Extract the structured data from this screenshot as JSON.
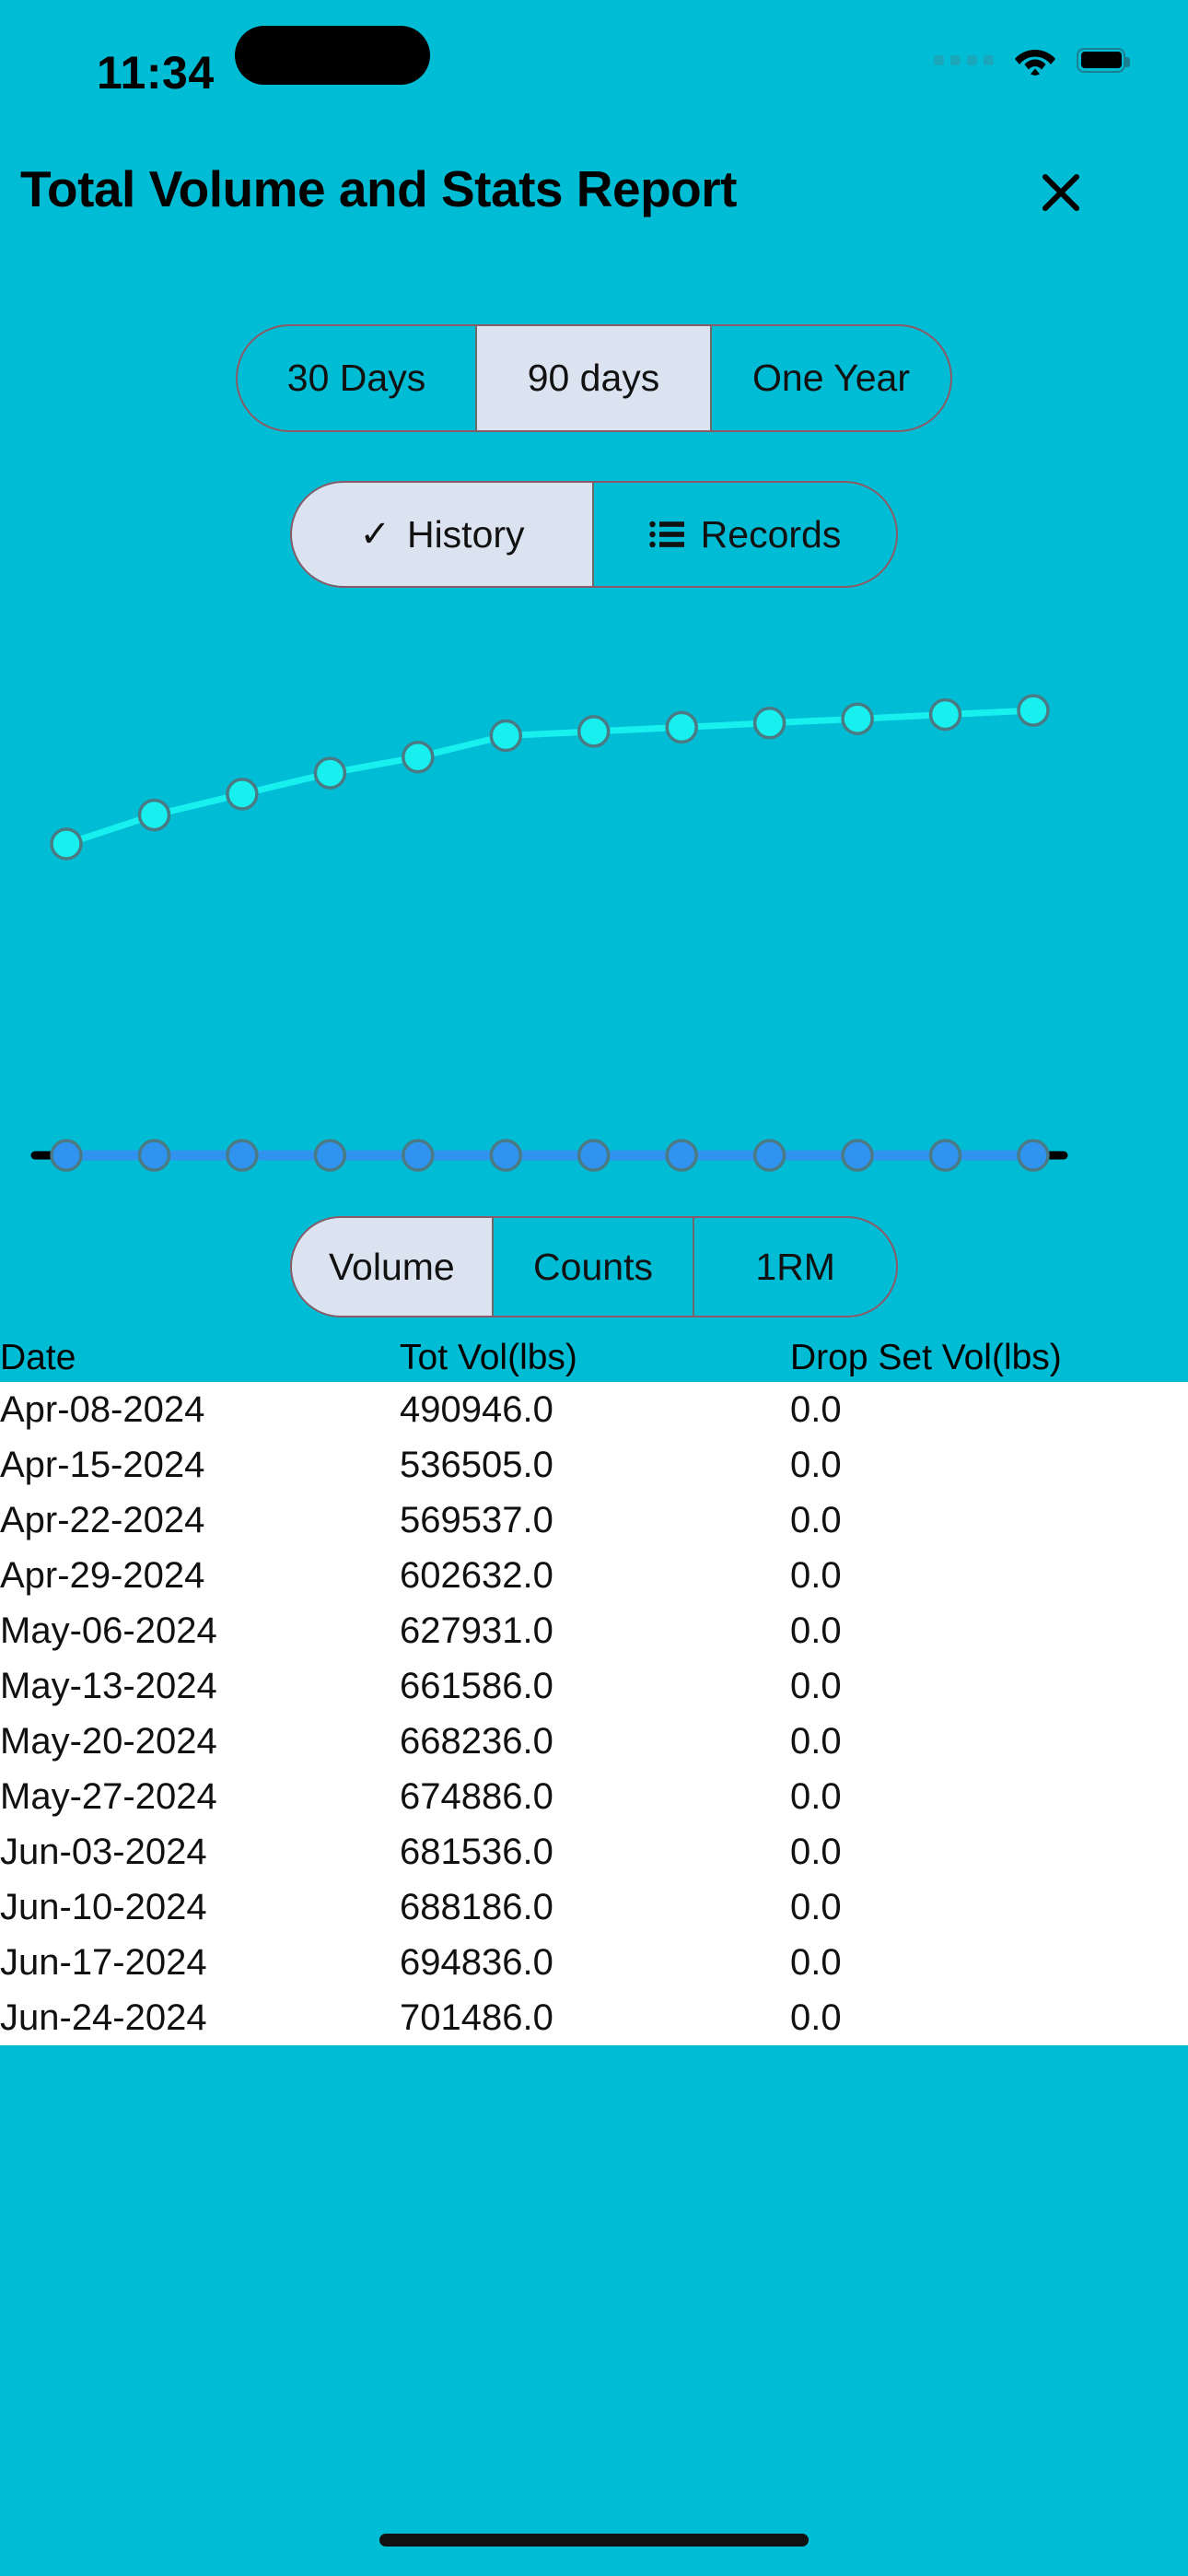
{
  "status_bar": {
    "time": "11:34",
    "cellular_icon": "cellular-signal-icon",
    "wifi_icon": "wifi-icon",
    "battery_icon": "battery-icon"
  },
  "header": {
    "title": "Total Volume and Stats Report",
    "close_label": "close-icon"
  },
  "range_selector": {
    "selected": "90 days",
    "options": [
      {
        "label": "30 Days",
        "active": false
      },
      {
        "label": "90 days",
        "active": true
      },
      {
        "label": "One Year",
        "active": false
      }
    ]
  },
  "mode_selector": {
    "selected": "History",
    "options": [
      {
        "label": "History",
        "icon": "check-icon",
        "active": true
      },
      {
        "label": "Records",
        "icon": "list-icon",
        "active": false
      }
    ]
  },
  "metric_selector": {
    "selected": "Volume",
    "options": [
      {
        "label": "Volume",
        "active": true
      },
      {
        "label": "Counts",
        "active": false
      },
      {
        "label": "1RM",
        "active": false
      }
    ]
  },
  "colors": {
    "background": "#00bcd4",
    "segment_active": "#dbe3f0",
    "segment_border": "#8b5a66",
    "line_primary": "#18f0f0",
    "line_secondary": "#2f93ef",
    "marker_stroke": "#4a7a84",
    "axis": "#000000",
    "table_background": "#ffffff"
  },
  "chart_data": {
    "type": "line",
    "title": "",
    "xlabel": "",
    "ylabel": "",
    "categories": [
      "Apr-08-2024",
      "Apr-15-2024",
      "Apr-22-2024",
      "Apr-29-2024",
      "May-06-2024",
      "May-13-2024",
      "May-20-2024",
      "May-27-2024",
      "Jun-03-2024",
      "Jun-10-2024",
      "Jun-17-2024",
      "Jun-24-2024"
    ],
    "series": [
      {
        "name": "Tot Vol(lbs)",
        "color": "#18f0f0",
        "values": [
          490946.0,
          536505.0,
          569537.0,
          602632.0,
          627931.0,
          661586.0,
          668236.0,
          674886.0,
          681536.0,
          688186.0,
          694836.0,
          701486.0
        ]
      },
      {
        "name": "Drop Set Vol(lbs)",
        "color": "#2f93ef",
        "values": [
          0.0,
          0.0,
          0.0,
          0.0,
          0.0,
          0.0,
          0.0,
          0.0,
          0.0,
          0.0,
          0.0,
          0.0
        ]
      }
    ],
    "ylim": [
      0,
      780000
    ],
    "grid": false,
    "legend": "none"
  },
  "table": {
    "headers": [
      "Date",
      "Tot Vol(lbs)",
      "Drop Set Vol(lbs)"
    ],
    "rows": [
      {
        "date": "Apr-08-2024",
        "vol": "490946.0",
        "drop": "0.0"
      },
      {
        "date": "Apr-15-2024",
        "vol": "536505.0",
        "drop": "0.0"
      },
      {
        "date": "Apr-22-2024",
        "vol": "569537.0",
        "drop": "0.0"
      },
      {
        "date": "Apr-29-2024",
        "vol": "602632.0",
        "drop": "0.0"
      },
      {
        "date": "May-06-2024",
        "vol": "627931.0",
        "drop": "0.0"
      },
      {
        "date": "May-13-2024",
        "vol": "661586.0",
        "drop": "0.0"
      },
      {
        "date": "May-20-2024",
        "vol": "668236.0",
        "drop": "0.0"
      },
      {
        "date": "May-27-2024",
        "vol": "674886.0",
        "drop": "0.0"
      },
      {
        "date": "Jun-03-2024",
        "vol": "681536.0",
        "drop": "0.0"
      },
      {
        "date": "Jun-10-2024",
        "vol": "688186.0",
        "drop": "0.0"
      },
      {
        "date": "Jun-17-2024",
        "vol": "694836.0",
        "drop": "0.0"
      },
      {
        "date": "Jun-24-2024",
        "vol": "701486.0",
        "drop": "0.0"
      }
    ]
  }
}
